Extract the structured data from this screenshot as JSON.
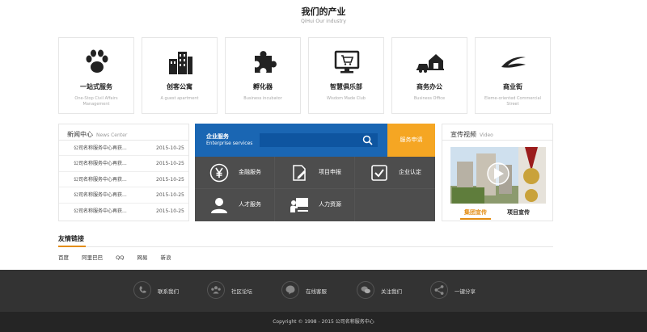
{
  "industry": {
    "title": "我们的产业",
    "subtitle": "QiHui Our industry",
    "cards": [
      {
        "name": "一站式服务",
        "desc": "One-Stop Civil Affairs Management",
        "icon": "paw-icon"
      },
      {
        "name": "创客公寓",
        "desc": "A guest apartment",
        "icon": "buildings-icon"
      },
      {
        "name": "孵化器",
        "desc": "Business incubator",
        "icon": "puzzle-icon"
      },
      {
        "name": "智慧俱乐部",
        "desc": "Wisdom Made Club",
        "icon": "monitor-cart-icon"
      },
      {
        "name": "商务办公",
        "desc": "Business Office",
        "icon": "house-car-icon"
      },
      {
        "name": "商业街",
        "desc": "Eleme-oriented Commercial Street",
        "icon": "swoosh-icon"
      }
    ]
  },
  "news": {
    "title": "新闻中心",
    "title_en": "News Center",
    "items": [
      {
        "text": "公司名称服务中心再获...",
        "date": "2015-10-25"
      },
      {
        "text": "公司名称服务中心再获...",
        "date": "2015-10-25"
      },
      {
        "text": "公司名称服务中心再获...",
        "date": "2015-10-25"
      },
      {
        "text": "公司名称服务中心再获...",
        "date": "2015-10-25"
      },
      {
        "text": "公司名称服务中心再获...",
        "date": "2015-10-25"
      }
    ]
  },
  "services": {
    "title": "企业服务",
    "title_en": "Enterprise services",
    "search_placeholder": "",
    "apply_label": "服务申请",
    "tiles": [
      {
        "label": "金融服务",
        "icon": "yen-icon"
      },
      {
        "label": "项目申报",
        "icon": "document-edit-icon"
      },
      {
        "label": "企业认定",
        "icon": "checkbox-icon"
      },
      {
        "label": "人才服务",
        "icon": "person-icon"
      },
      {
        "label": "人力资源",
        "icon": "presenter-icon"
      }
    ]
  },
  "video": {
    "title": "宣传视频",
    "title_en": "Video",
    "tabs": [
      "集团宣传",
      "项目宣传"
    ],
    "active_tab": "集团宣传"
  },
  "links": {
    "title": "友情链接",
    "items": [
      "百度",
      "阿里巴巴",
      "QQ",
      "网易",
      "新浪"
    ]
  },
  "footer": {
    "items": [
      {
        "label": "联系我们",
        "icon": "phone-icon"
      },
      {
        "label": "社区论坛",
        "icon": "community-icon"
      },
      {
        "label": "在线客服",
        "icon": "chat-icon"
      },
      {
        "label": "关注我们",
        "icon": "wechat-icon"
      },
      {
        "label": "一键分享",
        "icon": "share-icon"
      }
    ],
    "copyright": "Copyright © 1998 - 2015 公司名称服务中心"
  },
  "colors": {
    "primary_blue": "#1a66b3",
    "accent_orange": "#f5a623",
    "tile_gray": "#4d4d4d",
    "footer_dark": "#333333"
  }
}
